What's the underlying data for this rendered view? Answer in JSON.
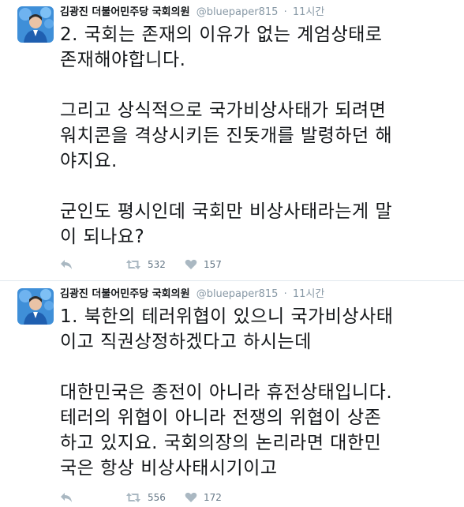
{
  "tweets": [
    {
      "author_name": "김광진 더불어민주당 국회의원",
      "handle": "@bluepaper815",
      "separator": "·",
      "time": "11시간",
      "text": "2. 국회는 존재의 이유가 없는 계엄상태로\n존재해야합니다.\n\n그리고 상식적으로 국가비상사태가 되려면\n워치콘을 격상시키든 진돗개를 발령하던 해\n야지요.\n\n군인도 평시인데 국회만 비상사태라는게 말\n이 되나요?",
      "retweets": "532",
      "likes": "157"
    },
    {
      "author_name": "김광진 더불어민주당 국회의원",
      "handle": "@bluepaper815",
      "separator": "·",
      "time": "11시간",
      "text": "1. 북한의 테러위협이 있으니 국가비상사태\n이고 직권상정하겠다고 하시는데\n\n대한민국은 종전이 아니라 휴전상태입니다.\n테러의 위협이 아니라 전쟁의 위협이 상존\n하고 있지요. 국회의장의 논리라면 대한민\n국은 항상 비상사태시기이고",
      "retweets": "556",
      "likes": "172"
    }
  ],
  "icons": {
    "reply": "reply-icon",
    "retweet": "retweet-icon",
    "like": "heart-icon"
  },
  "colors": {
    "text": "#14171a",
    "meta": "#8899a6",
    "divider": "#e1e8ed",
    "avatar_bg": "#3f8fd8"
  }
}
